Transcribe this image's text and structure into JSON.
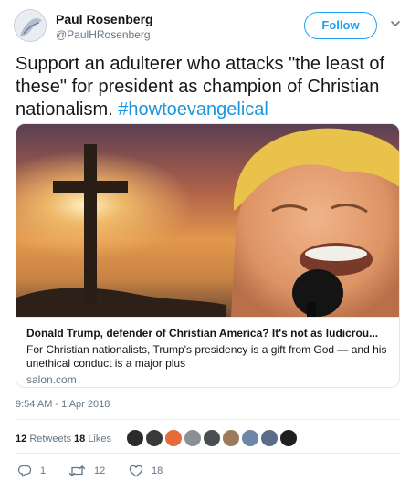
{
  "user": {
    "display_name": "Paul Rosenberg",
    "handle": "@PaulHRosenberg"
  },
  "follow_label": "Follow",
  "tweet": {
    "text": "Support an adulterer who attacks \"the least of these\" for president as champion of Christian nationalism. ",
    "hashtag": "#howtoevangelical"
  },
  "card": {
    "title": "Donald Trump, defender of Christian America? It's not as ludicrou...",
    "description": "For Christian nationalists, Trump's presidency is a gift from God — and his unethical conduct is a major plus",
    "domain": "salon.com"
  },
  "timestamp": "9:54 AM - 1 Apr 2018",
  "stats": {
    "retweets_count": "12",
    "retweets_label": "Retweets",
    "likes_count": "18",
    "likes_label": "Likes"
  },
  "likers_colors": [
    "#2b2b2b",
    "#3a3a3a",
    "#e46b3a",
    "#8b8f96",
    "#4a4d52",
    "#9a7b5a",
    "#6e87a8",
    "#5a6c86",
    "#1f1f1f",
    "#d9d9d9"
  ],
  "actions": {
    "reply_count": "1",
    "retweet_count": "12",
    "like_count": "18"
  },
  "icons": [
    "reply-icon",
    "retweet-icon",
    "heart-icon",
    "chevron-down-icon"
  ],
  "colors": {
    "accent": "#1da1f2",
    "hashtag": "#1b95e0",
    "muted": "#657786"
  }
}
